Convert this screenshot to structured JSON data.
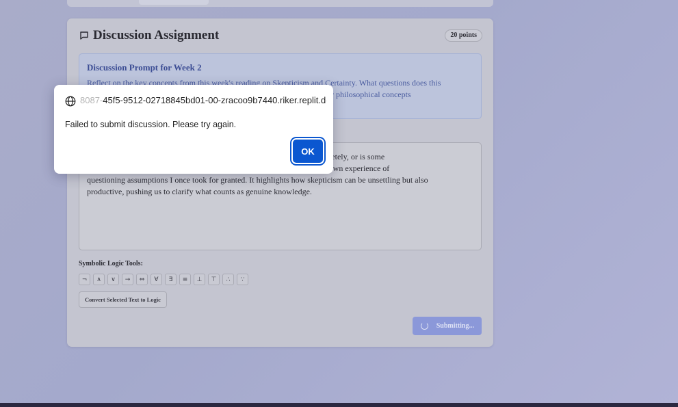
{
  "assignment": {
    "title": "Discussion Assignment",
    "points": "20 points",
    "prompt_title": "Discussion Prompt for Week 2",
    "prompt_line1": "Reflect on the key concepts from this week's reading on Skepticism and Certainty. What questions does this",
    "prompt_line2": "rience or other philosophical concepts",
    "response_line1": "escape doubt completely, or is some",
    "response_line2": "uth and also to my own experience of",
    "response_line3": "questioning assumptions I once took for granted. It highlights how skepticism can be unsettling but also",
    "response_line4": "productive, pushing us to clarify what counts as genuine knowledge.",
    "logic_label": "Symbolic Logic Tools:",
    "symbols": [
      "¬",
      "∧",
      "∨",
      "→",
      "⇔",
      "∀",
      "∃",
      "≡",
      "⊥",
      "⊤",
      "∴",
      "∵"
    ],
    "convert_label": "Convert Selected Text to Logic",
    "submit_label": "Submitting..."
  },
  "dialog": {
    "origin_faded": "8087-",
    "origin": "45f5-9512-02718845bd01-00-zracoo9b7440.riker.replit.dev",
    "message": "Failed to submit discussion. Please try again.",
    "ok_label": "OK"
  },
  "colors": {
    "accent": "#0b57d0",
    "prompt_text": "#4a5c9f",
    "submit_bg": "#8b98d9"
  }
}
